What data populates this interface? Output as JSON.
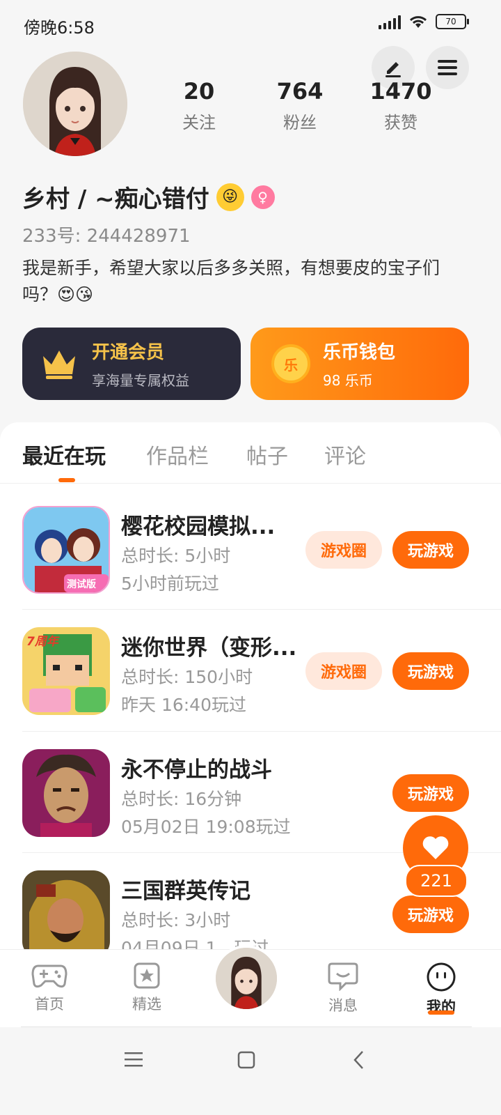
{
  "status_bar": {
    "time": "傍晚6:58",
    "battery": "70"
  },
  "profile": {
    "username": "乡村 / ~痴心错付",
    "uid_label": "233号: 244428971",
    "bio": "我是新手，希望大家以后多多关照，有想要皮的宝子们吗？😍😘",
    "stats": [
      {
        "value": "20",
        "label": "关注"
      },
      {
        "value": "764",
        "label": "粉丝"
      },
      {
        "value": "1470",
        "label": "获赞"
      }
    ]
  },
  "cards": {
    "vip": {
      "title": "开通会员",
      "subtitle": "享海量专属权益"
    },
    "wallet": {
      "title": "乐币钱包",
      "subtitle": "98 乐币",
      "coin_glyph": "乐"
    }
  },
  "tabs": [
    "最近在玩",
    "作品栏",
    "帖子",
    "评论"
  ],
  "games": [
    {
      "title": "樱花校园模拟...",
      "duration": "总时长: 5小时",
      "last_played": "5小时前玩过",
      "circle_label": "游戏圈",
      "play_label": "玩游戏",
      "icon_badge": "测试版"
    },
    {
      "title": "迷你世界（变形...",
      "duration": "总时长: 150小时",
      "last_played": "昨天 16:40玩过",
      "circle_label": "游戏圈",
      "play_label": "玩游戏",
      "icon_badge": "7周年"
    },
    {
      "title": "永不停止的战斗",
      "duration": "总时长: 16分钟",
      "last_played": "05月02日 19:08玩过",
      "play_label": "玩游戏"
    },
    {
      "title": "三国群英传记",
      "duration": "总时长: 3小时",
      "last_played": "04月09日 1…玩过",
      "play_label": "玩游戏"
    }
  ],
  "like": {
    "count": "221"
  },
  "bottom_nav": [
    {
      "label": "首页"
    },
    {
      "label": "精选"
    },
    {
      "label": ""
    },
    {
      "label": "消息"
    },
    {
      "label": "我的"
    }
  ],
  "colors": {
    "accent": "#ff6a0a",
    "vip_bg": "#2a2a3a",
    "gold": "#f5c24a"
  }
}
